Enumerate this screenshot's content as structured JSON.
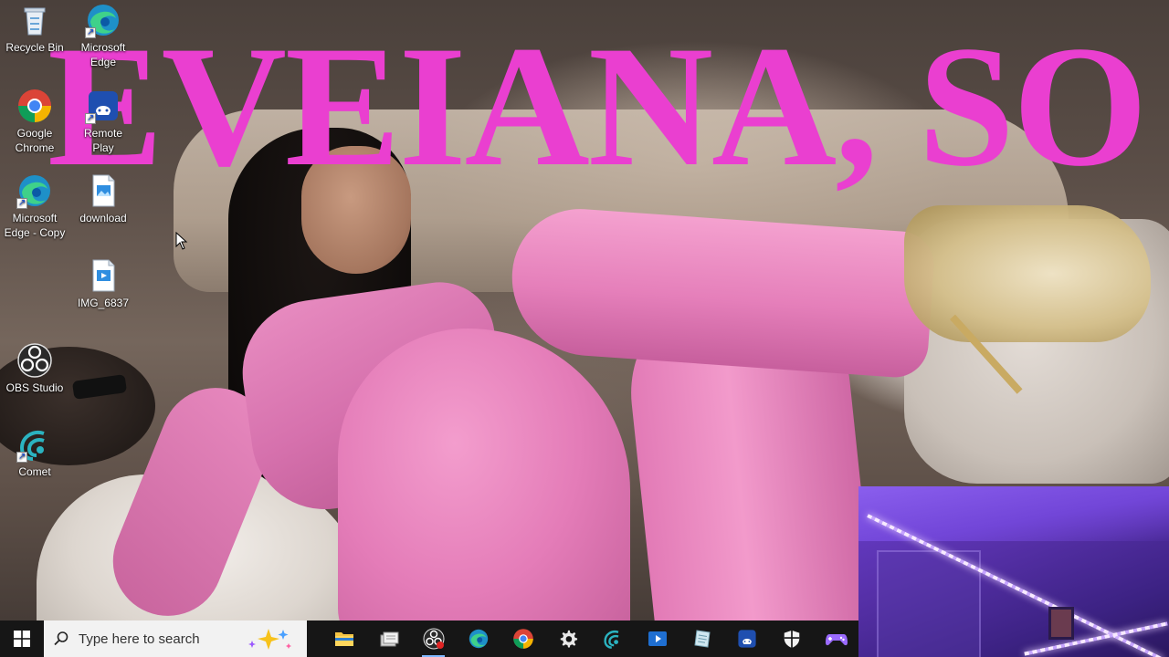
{
  "wallpaper": {
    "overlay_text": "EVEIANA, SO",
    "overlay_color": "#ea3fd0"
  },
  "desktop_icons": [
    {
      "name": "recycle-bin",
      "label": "Recycle Bin",
      "icon": "recycle-bin-icon"
    },
    {
      "name": "microsoft-edge",
      "label": "Microsoft\nEdge",
      "icon": "edge-icon"
    },
    {
      "name": "google-chrome",
      "label": "Google Chrome",
      "icon": "chrome-icon"
    },
    {
      "name": "remote-play",
      "label": "Remote\nPlay",
      "icon": "remote-play-icon"
    },
    {
      "name": "microsoft-edge-copy",
      "label": "Microsoft Edge - Copy",
      "icon": "edge-icon"
    },
    {
      "name": "download",
      "label": "download",
      "icon": "image-file-icon"
    },
    {
      "name": "img-6837",
      "label": "IMG_6837",
      "icon": "image-file-icon"
    },
    {
      "name": "obs-studio",
      "label": "OBS Studio",
      "icon": "obs-icon"
    },
    {
      "name": "comet",
      "label": "Comet",
      "icon": "comet-icon"
    }
  ],
  "taskbar": {
    "search_placeholder": "Type here to search",
    "apps": [
      {
        "name": "file-explorer",
        "icon": "folder-icon"
      },
      {
        "name": "files",
        "icon": "files-icon"
      },
      {
        "name": "obs-studio",
        "icon": "obs-icon",
        "active": true
      },
      {
        "name": "microsoft-edge",
        "icon": "edge-icon"
      },
      {
        "name": "google-chrome",
        "icon": "chrome-icon"
      },
      {
        "name": "settings",
        "icon": "gear-icon"
      },
      {
        "name": "comet",
        "icon": "comet-icon"
      },
      {
        "name": "media-player",
        "icon": "media-player-icon"
      },
      {
        "name": "notepad",
        "icon": "notepad-icon"
      },
      {
        "name": "remote-play",
        "icon": "remote-play-icon"
      },
      {
        "name": "security",
        "icon": "shield-icon"
      },
      {
        "name": "game-controller",
        "icon": "game-controller-icon"
      }
    ]
  },
  "colors": {
    "taskbar_bg": "#161616",
    "search_bg": "#f2f2f2",
    "accent": "#0078d4"
  }
}
